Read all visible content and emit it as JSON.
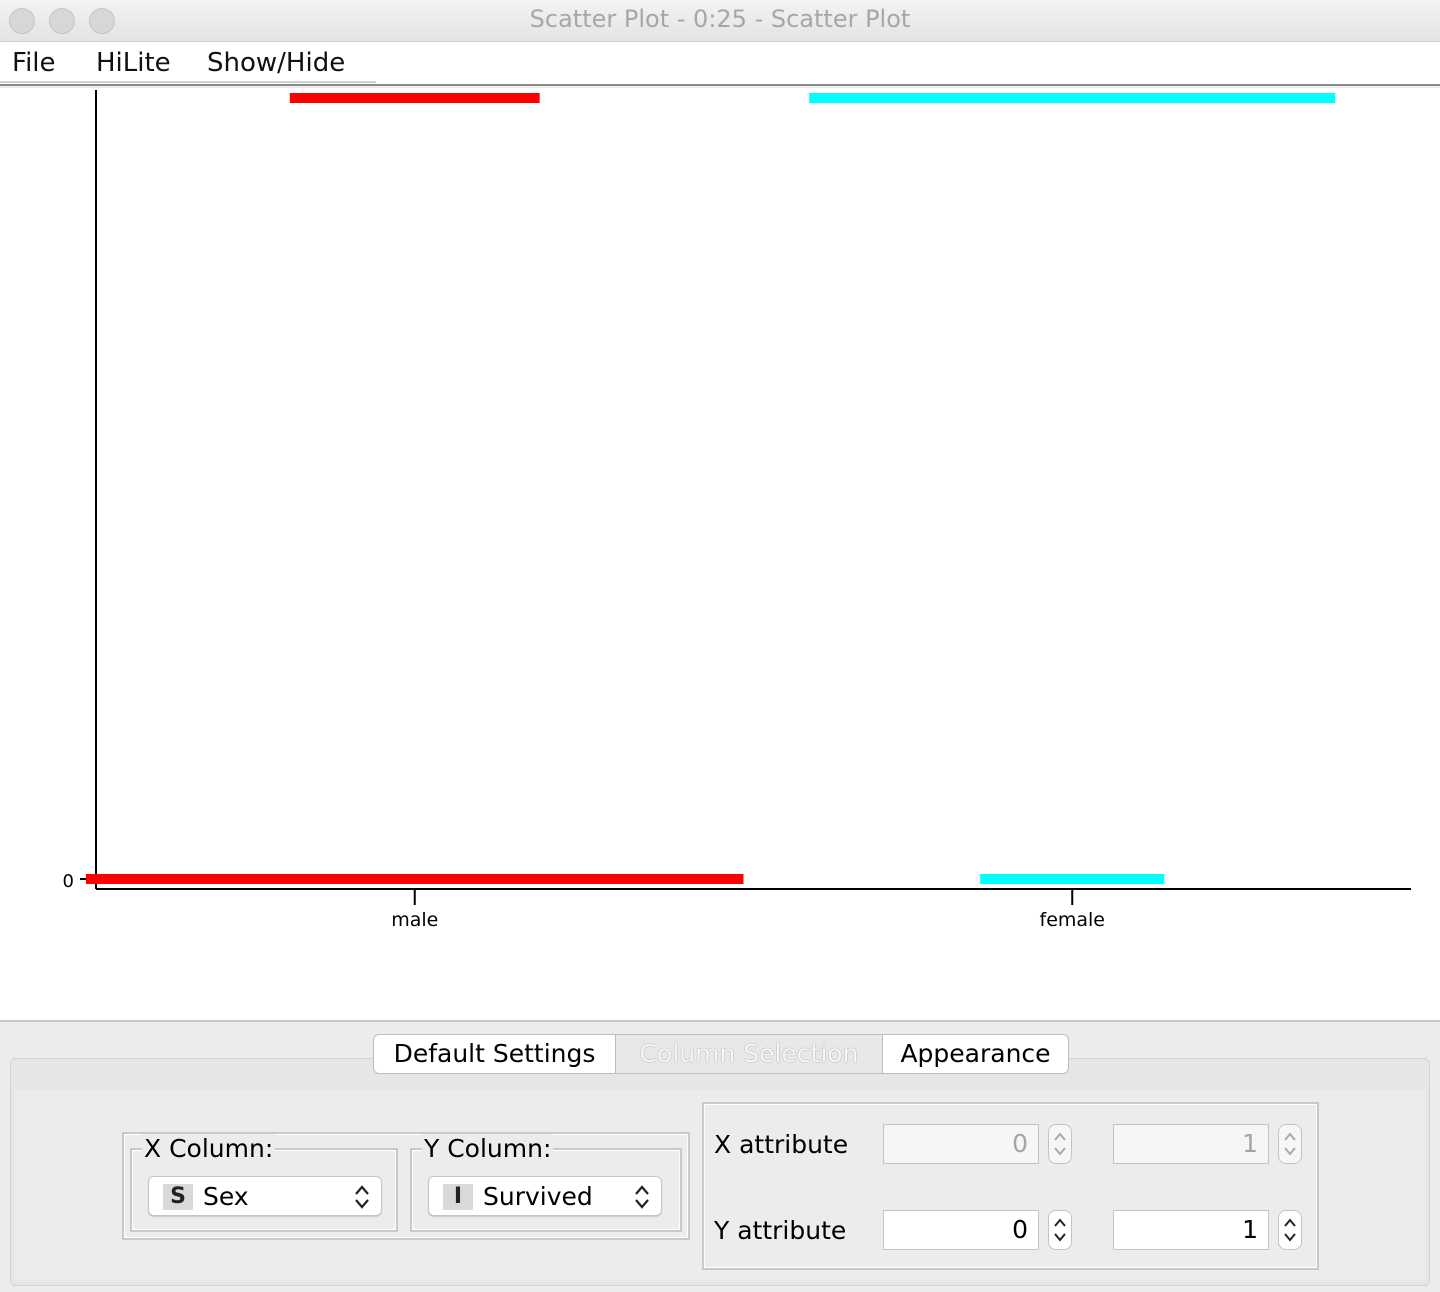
{
  "window": {
    "title": "Scatter Plot - 0:25 - Scatter Plot"
  },
  "menu": {
    "items": [
      "File",
      "HiLite",
      "Show/Hide"
    ]
  },
  "chart_data": {
    "type": "scatter",
    "x_categories": [
      "male",
      "female"
    ],
    "y_tick_labels": [
      "0"
    ],
    "series": [
      {
        "color": "#ff0000",
        "category": "male",
        "y_values": [
          1,
          0
        ],
        "jitter_extent": [
          0.38,
          1.0
        ]
      },
      {
        "color": "#00ffff",
        "category": "female",
        "y_values": [
          1,
          0
        ],
        "jitter_extent": [
          0.8,
          0.28
        ]
      }
    ],
    "colors": {
      "male": "#ff0000",
      "female": "#00ffff"
    },
    "grid": false
  },
  "tabs": [
    {
      "label": "Default Settings",
      "active": false
    },
    {
      "label": "Column Selection",
      "active": true
    },
    {
      "label": "Appearance",
      "active": false
    }
  ],
  "columns": {
    "x_label": "X Column:",
    "x_value": "Sex",
    "x_type_badge": "S",
    "y_label": "Y Column:",
    "y_value": "Survived",
    "y_type_badge": "I"
  },
  "attributes": {
    "x_label": "X attribute",
    "x_min": "0",
    "x_max": "1",
    "x_enabled": false,
    "y_label": "Y attribute",
    "y_min": "0",
    "y_max": "1",
    "y_enabled": true
  }
}
